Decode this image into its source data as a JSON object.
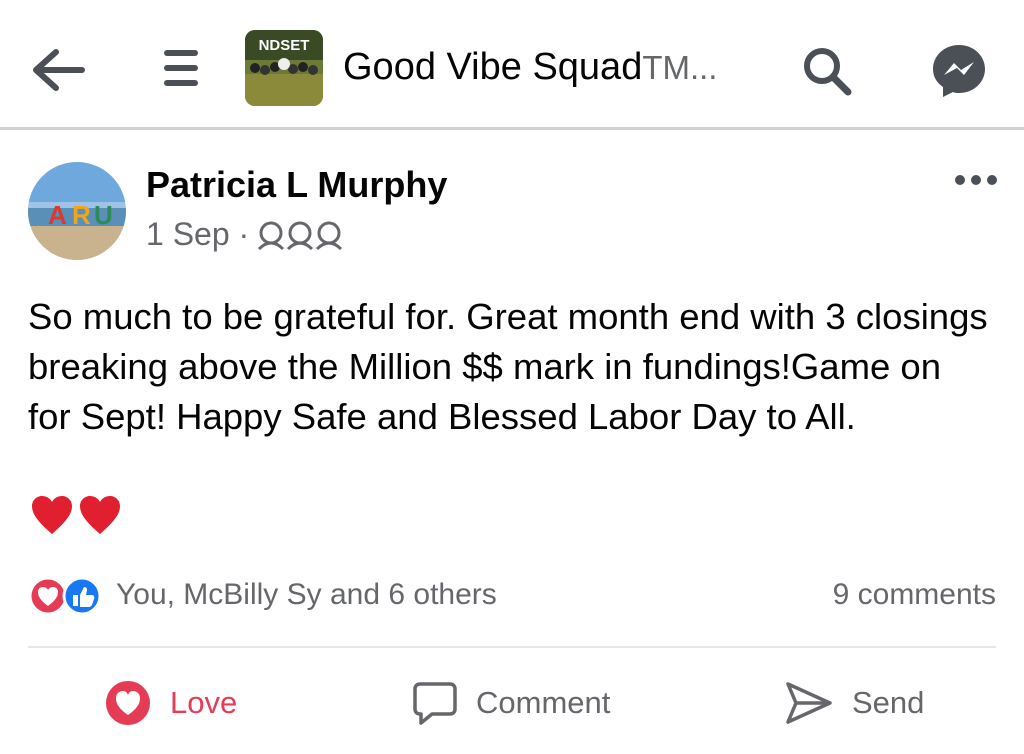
{
  "header": {
    "group_title": "Good Vibe Squad",
    "group_title_suffix": "TM...",
    "group_thumb_text": "NDSET",
    "icons": [
      "back-arrow-icon",
      "menu-icon",
      "search-icon",
      "messenger-icon"
    ]
  },
  "post": {
    "author": "Patricia L Murphy",
    "date": "1 Sep ·",
    "privacy_icon": "group-members-icon",
    "body": "So much to be grateful for. Great month end with 3 closings  breaking above the Million $$ mark in fundings!Game on for Sept! Happy Safe and Blessed Labor Day to All.",
    "emoji": "heart-emoji x2"
  },
  "reactions": {
    "summary": "You, McBilly Sy and 6 others",
    "comments": "9 comments",
    "icons": [
      "love-reaction-icon",
      "like-reaction-icon"
    ]
  },
  "actions": {
    "love": "Love",
    "comment": "Comment",
    "send": "Send"
  },
  "colors": {
    "love_red": "#e53b55",
    "like_blue": "#1877f2",
    "secondary_text": "#65676b"
  }
}
